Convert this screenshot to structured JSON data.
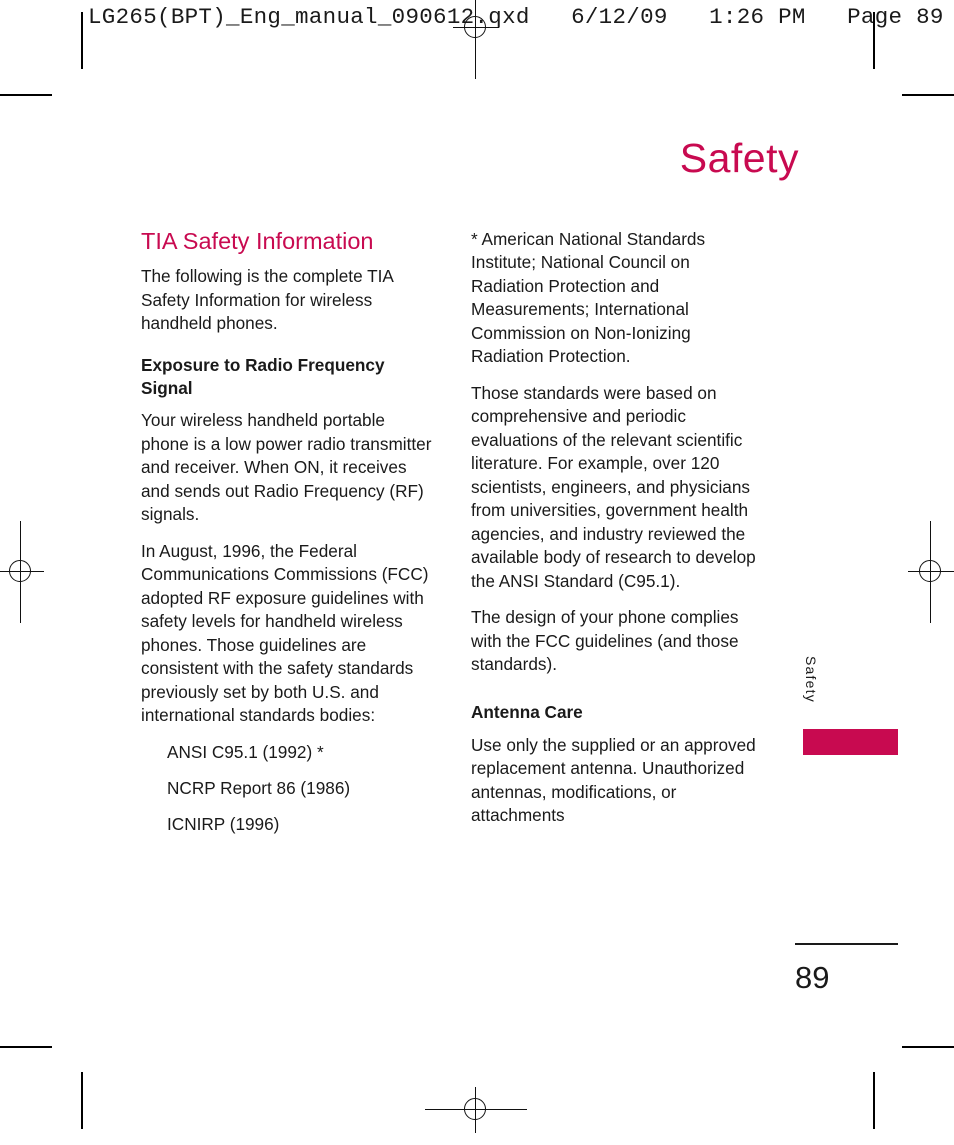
{
  "preflight": {
    "header": "LG265(BPT)_Eng_manual_090612.qxd   6/12/09   1:26 PM   Page 89"
  },
  "page": {
    "title": "Safety",
    "accent_color": "#C80A50",
    "text_color": "#1a1a1a",
    "folio": "89",
    "side_tab_label": "Safety"
  },
  "left_column": {
    "section_title": "TIA Safety Information",
    "intro": "The following is the complete TIA Safety Information for wireless handheld phones.",
    "subheading": "Exposure to Radio Frequency Signal",
    "para_1": "Your wireless handheld portable phone is a low power radio transmitter and receiver. When ON, it receives and sends out Radio Frequency (RF) signals.",
    "para_2": "In August, 1996, the Federal Communications Commissions (FCC) adopted RF exposure guidelines with safety levels for handheld wireless phones. Those guidelines are consistent with the safety standards previously set by both U.S. and international standards bodies:",
    "standards": [
      "ANSI C95.1 (1992) *",
      "NCRP Report 86 (1986)",
      "ICNIRP (1996)"
    ]
  },
  "right_column": {
    "footnote": "* American National Standards Institute; National Council on Radiation Protection and Measurements; International Commission on Non-Ionizing Radiation Protection.",
    "para_1": "Those standards were based on comprehensive and periodic evaluations of the relevant scientific literature. For example, over 120 scientists, engineers, and physicians from universities, government health agencies, and industry reviewed the available body of research to develop the ANSI Standard (C95.1).",
    "para_2": "The design of your phone complies with the FCC guidelines (and those standards).",
    "subheading": "Antenna Care",
    "para_3": "Use only the supplied or an approved replacement antenna. Unauthorized antennas, modifications, or attachments"
  }
}
